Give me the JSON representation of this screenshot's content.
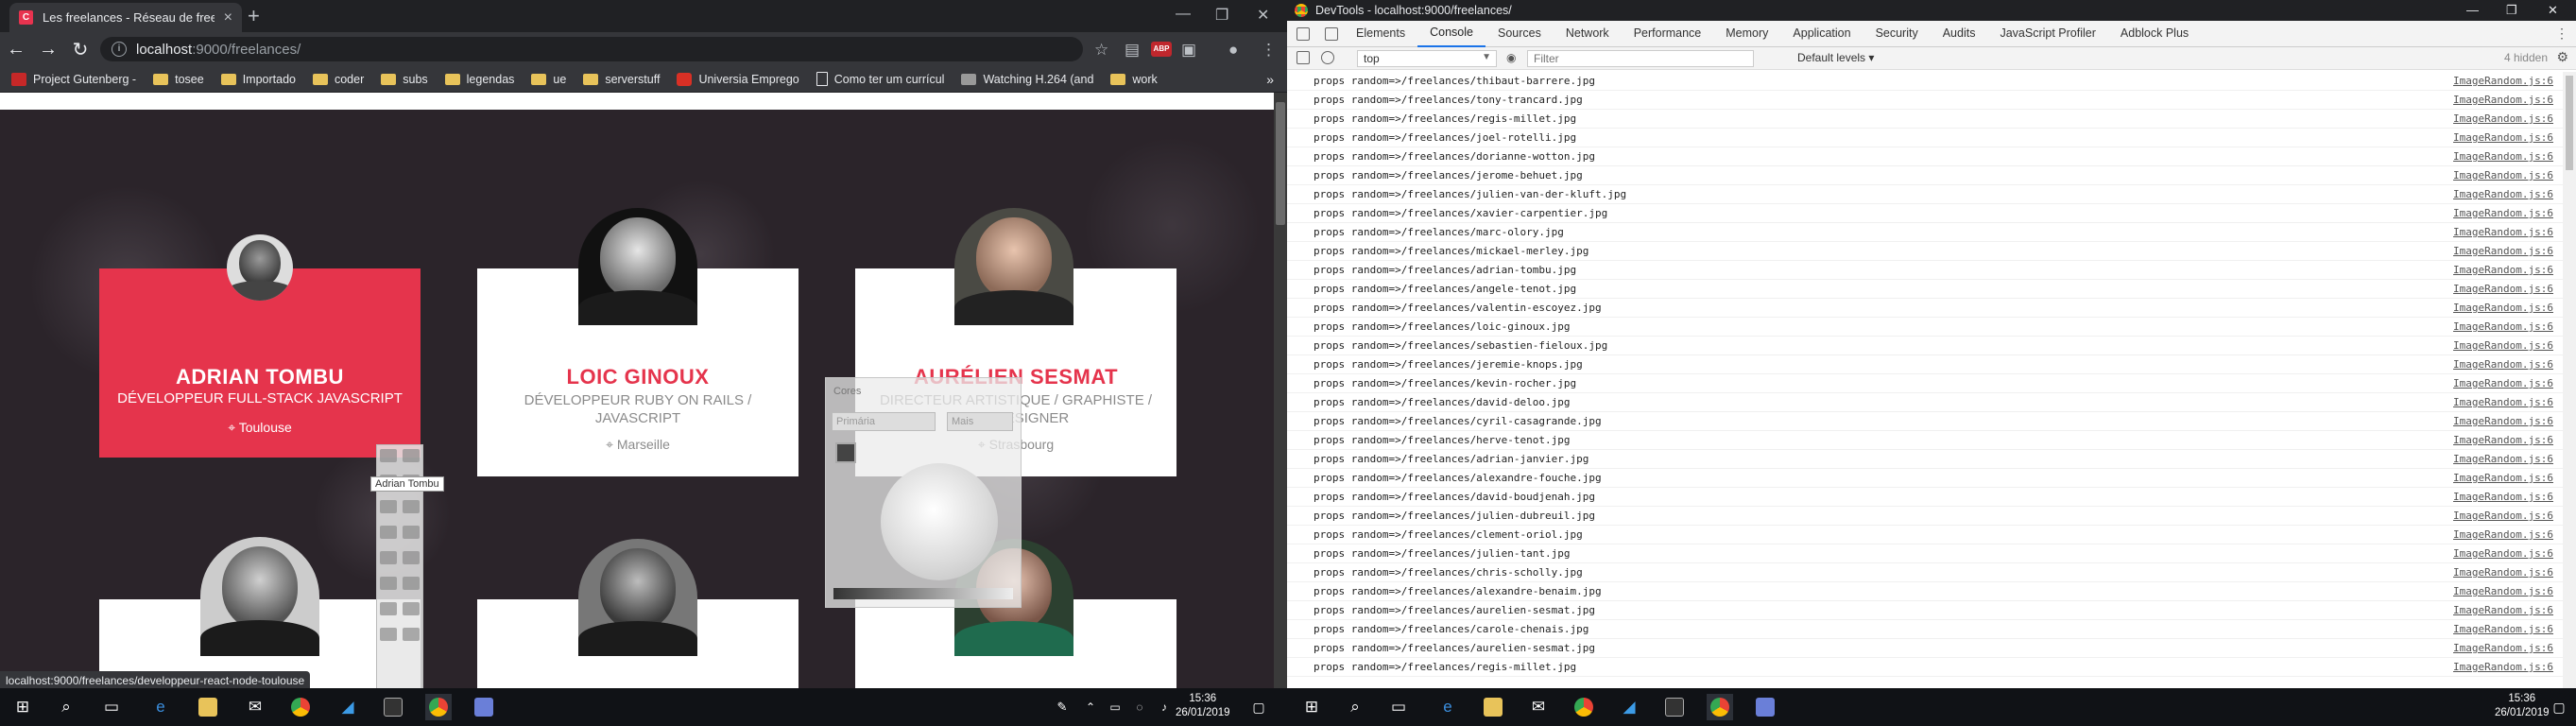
{
  "browser": {
    "tab_title": "Les freelances - Réseau de freelances",
    "tab_close": "×",
    "new_tab": "+",
    "url_host": "localhost",
    "url_rest": ":9000/freelances/",
    "bookmarks": [
      {
        "label": "Project Gutenberg -",
        "icon": "gutenberg-icon"
      },
      {
        "label": "tosee",
        "icon": "folder-icon"
      },
      {
        "label": "Importado",
        "icon": "folder-icon"
      },
      {
        "label": "coder",
        "icon": "folder-icon"
      },
      {
        "label": "subs",
        "icon": "folder-icon"
      },
      {
        "label": "legendas",
        "icon": "folder-icon"
      },
      {
        "label": "ue",
        "icon": "folder-icon"
      },
      {
        "label": "serverstuff",
        "icon": "folder-icon"
      },
      {
        "label": "Universia Emprego",
        "icon": "universia-icon"
      },
      {
        "label": "Como ter um currícul",
        "icon": "doc-icon"
      },
      {
        "label": "Watching H.264 (and",
        "icon": "video-icon"
      },
      {
        "label": "work",
        "icon": "folder-icon"
      }
    ],
    "bookmarks_more": "»",
    "abp_label": "ABP",
    "status_url": "localhost:9000/freelances/developpeur-react-node-toulouse"
  },
  "cards": [
    {
      "name": "ADRIAN TOMBU",
      "role": "DÉVELOPPEUR FULL-STACK JAVASCRIPT",
      "location": "Toulouse"
    },
    {
      "name": "LOIC GINOUX",
      "role": "DÉVELOPPEUR RUBY ON RAILS / JAVASCRIPT",
      "location": "Marseille"
    },
    {
      "name": "AURÉLIEN SESMAT",
      "role": "DIRECTEUR ARTISTIQUE / GRAPHISTE / WEBDESIGNER",
      "location": "Strasbourg"
    }
  ],
  "overlays": {
    "tooltip": "Adrian Tombu",
    "colors_label": "Cores",
    "colors_primary": "Primária",
    "colors_more": "Mais"
  },
  "devtools": {
    "title": "DevTools - localhost:9000/freelances/",
    "tabs": [
      "Elements",
      "Console",
      "Sources",
      "Network",
      "Performance",
      "Memory",
      "Application",
      "Security",
      "Audits",
      "JavaScript Profiler",
      "Adblock Plus"
    ],
    "active_tab": "Console",
    "context": "top",
    "filter_placeholder": "Filter",
    "levels": "Default levels",
    "hidden": "4 hidden",
    "log_source": "ImageRandom.js:6",
    "logs": [
      "props random=>/freelances/thibaut-barrere.jpg",
      "props random=>/freelances/tony-trancard.jpg",
      "props random=>/freelances/regis-millet.jpg",
      "props random=>/freelances/joel-rotelli.jpg",
      "props random=>/freelances/dorianne-wotton.jpg",
      "props random=>/freelances/jerome-behuet.jpg",
      "props random=>/freelances/julien-van-der-kluft.jpg",
      "props random=>/freelances/xavier-carpentier.jpg",
      "props random=>/freelances/marc-olory.jpg",
      "props random=>/freelances/mickael-merley.jpg",
      "props random=>/freelances/adrian-tombu.jpg",
      "props random=>/freelances/angele-tenot.jpg",
      "props random=>/freelances/valentin-escoyez.jpg",
      "props random=>/freelances/loic-ginoux.jpg",
      "props random=>/freelances/sebastien-fieloux.jpg",
      "props random=>/freelances/jeremie-knops.jpg",
      "props random=>/freelances/kevin-rocher.jpg",
      "props random=>/freelances/david-deloo.jpg",
      "props random=>/freelances/cyril-casagrande.jpg",
      "props random=>/freelances/herve-tenot.jpg",
      "props random=>/freelances/adrian-janvier.jpg",
      "props random=>/freelances/alexandre-fouche.jpg",
      "props random=>/freelances/david-boudjenah.jpg",
      "props random=>/freelances/julien-dubreuil.jpg",
      "props random=>/freelances/clement-oriol.jpg",
      "props random=>/freelances/julien-tant.jpg",
      "props random=>/freelances/chris-scholly.jpg",
      "props random=>/freelances/alexandre-benaim.jpg",
      "props random=>/freelances/aurelien-sesmat.jpg",
      "props random=>/freelances/carole-chenais.jpg",
      "props random=>/freelances/aurelien-sesmat.jpg",
      "props random=>/freelances/regis-millet.jpg"
    ]
  },
  "taskbar": {
    "time_left": "15:36",
    "date_left": "26/01/2019",
    "time_right": "15:36",
    "date_right": "26/01/2019"
  }
}
